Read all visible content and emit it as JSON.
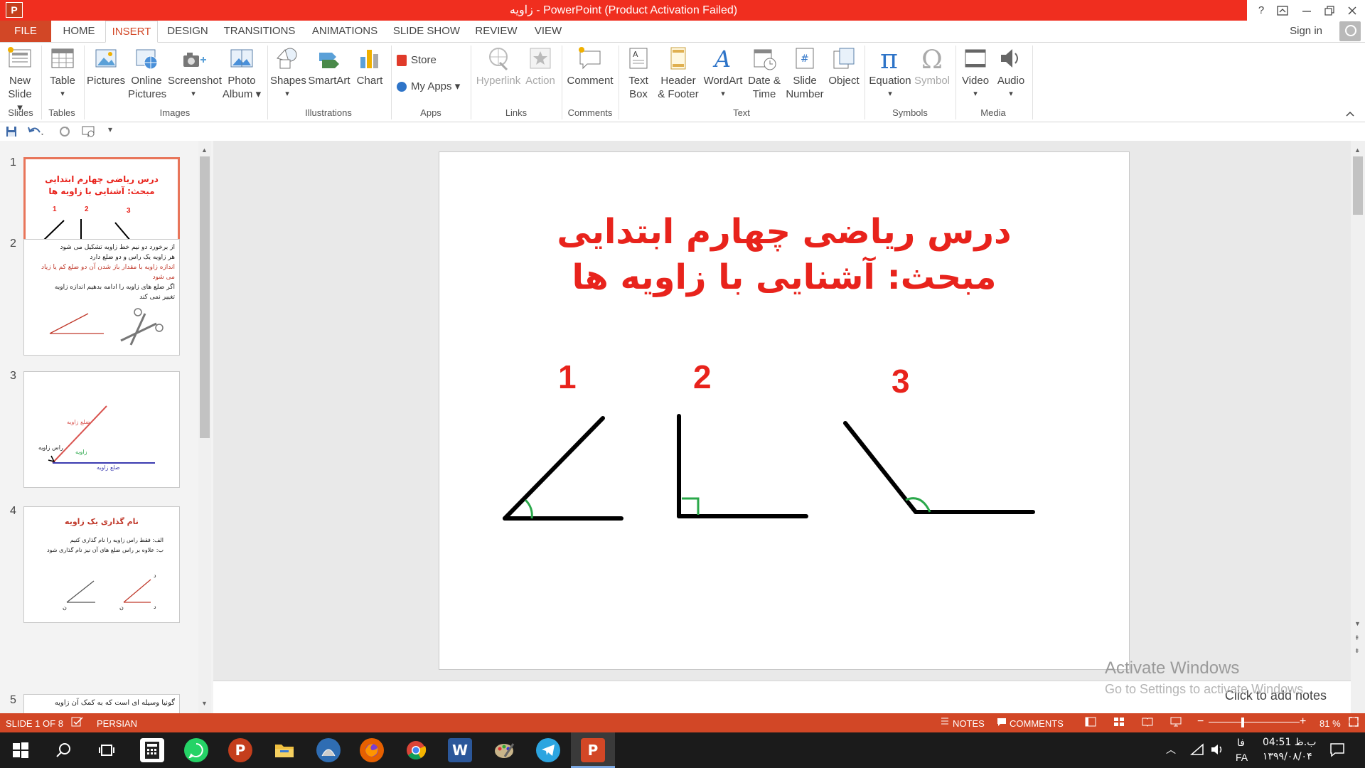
{
  "window": {
    "title": "زاویه  -  PowerPoint (Product Activation Failed)",
    "help": "?",
    "controls": [
      "ribbon-display",
      "minimize",
      "restore",
      "close"
    ]
  },
  "tabs": [
    {
      "label": "FILE"
    },
    {
      "label": "HOME"
    },
    {
      "label": "INSERT",
      "active": true
    },
    {
      "label": "DESIGN"
    },
    {
      "label": "TRANSITIONS"
    },
    {
      "label": "ANIMATIONS"
    },
    {
      "label": "SLIDE SHOW"
    },
    {
      "label": "REVIEW"
    },
    {
      "label": "VIEW"
    }
  ],
  "account": {
    "signin": "Sign in"
  },
  "ribbon": {
    "groups": {
      "slides": "Slides",
      "tables": "Tables",
      "images": "Images",
      "illustrations": "Illustrations",
      "apps": "Apps",
      "links": "Links",
      "comments": "Comments",
      "text": "Text",
      "symbols": "Symbols",
      "media": "Media"
    },
    "buttons": {
      "new_slide": [
        "New",
        "Slide ▾"
      ],
      "table": [
        "Table",
        "▾"
      ],
      "pictures": "Pictures",
      "online_pictures": [
        "Online",
        "Pictures"
      ],
      "screenshot": [
        "Screenshot",
        "▾"
      ],
      "photo_album": [
        "Photo",
        "Album ▾"
      ],
      "shapes": [
        "Shapes",
        "▾"
      ],
      "smartart": "SmartArt",
      "chart": "Chart",
      "store": "Store",
      "my_apps": "My Apps  ▾",
      "hyperlink": "Hyperlink",
      "action": "Action",
      "comment": "Comment",
      "text_box": [
        "Text",
        "Box"
      ],
      "header_footer": [
        "Header",
        "& Footer"
      ],
      "wordart": [
        "WordArt",
        "▾"
      ],
      "date_time": [
        "Date &",
        "Time"
      ],
      "slide_number": [
        "Slide",
        "Number"
      ],
      "object": "Object",
      "equation": [
        "Equation",
        "▾"
      ],
      "symbol": "Symbol",
      "video": [
        "Video",
        "▾"
      ],
      "audio": [
        "Audio",
        "▾"
      ]
    }
  },
  "thumbnails": [
    {
      "num": "1",
      "title1": "درس ریاضی چهارم ابتدایی",
      "title2": "مبحث: آشنایی با زاویه ها",
      "labels": [
        "1",
        "2",
        "3"
      ]
    },
    {
      "num": "2",
      "lines": [
        "از برخورد دو نیم خط زاویه تشکیل می شود",
        "هر زاویه یک راس و دو ضلع دارد",
        "اندازه زاویه با مقدار باز شدن آن دو ضلع کم یا زیاد",
        "می شود",
        "اگر ضلع های زاویه را ادامه بدهیم اندازه زاویه",
        "تغییر نمی کند"
      ]
    },
    {
      "num": "3",
      "labels": [
        "ضلع زاویه",
        "راس زاویه",
        "زاویه",
        "ضلع زاویه"
      ]
    },
    {
      "num": "4",
      "title": "نام گذاری یک زاویه",
      "bullets": [
        "الف: فقط راس زاویه را نام گذاری کنیم",
        "ب: علاوه بر راس ضلع های آن نیز نام گذاری شود"
      ],
      "point_labels": [
        "ن",
        "ن",
        "د",
        "د"
      ]
    },
    {
      "num": "5",
      "line": "گونیا وسیله ای است که به کمک آن زاویه"
    }
  ],
  "slide": {
    "title_line1": "درس ریاضی چهارم ابتدایی",
    "title_line2": "مبحث: آشنایی با زاویه ها",
    "angle_labels": [
      "1",
      "2",
      "3"
    ],
    "line_color": "#000000",
    "angle_mark_color": "#2aa84a",
    "title_color": "#e8231c"
  },
  "notes_placeholder": "Click to add notes",
  "watermark": {
    "line1": "Activate Windows",
    "line2": "Go to Settings to activate Windows."
  },
  "status": {
    "slide": "SLIDE 1 OF 8",
    "language": "PERSIAN",
    "notes": "NOTES",
    "comments": "COMMENTS",
    "zoom": "81 %"
  },
  "taskbar": {
    "lang_top": "فا",
    "lang_bottom": "FA",
    "time": "04:51 ب.ظ",
    "date": "۱۳۹۹/۰۸/۰۴"
  }
}
